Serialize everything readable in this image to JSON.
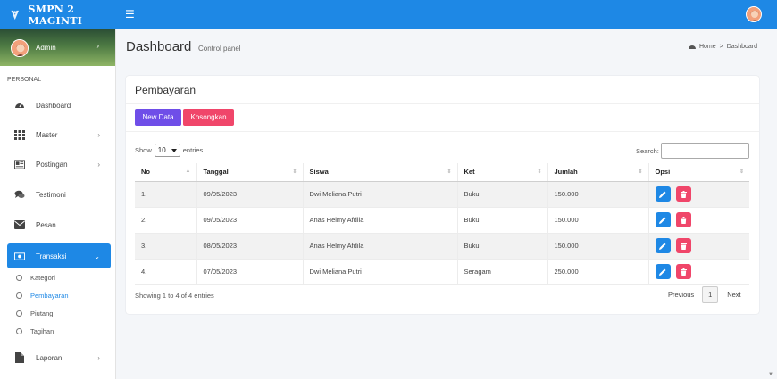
{
  "app": {
    "brand": "SMPN 2 MAGINTI",
    "menu_icon": "☰"
  },
  "colors": {
    "primary": "#1e88e5",
    "new_button": "#6f4ee8",
    "danger": "#f0466a"
  },
  "user": {
    "name": "Admin"
  },
  "sidebar": {
    "section": "PERSONAL",
    "items": [
      {
        "label": "Dashboard",
        "icon": "tachometer-icon",
        "has_chevron": false
      },
      {
        "label": "Master",
        "icon": "grid-icon",
        "has_chevron": true
      },
      {
        "label": "Postingan",
        "icon": "newspaper-icon",
        "has_chevron": true
      },
      {
        "label": "Testimoni",
        "icon": "comments-icon",
        "has_chevron": false
      },
      {
        "label": "Pesan",
        "icon": "envelope-icon",
        "has_chevron": false
      },
      {
        "label": "Transaksi",
        "icon": "money-icon",
        "has_chevron": true,
        "active": true
      },
      {
        "label": "Laporan",
        "icon": "file-icon",
        "has_chevron": true
      }
    ],
    "subitems": [
      {
        "label": "Kategori"
      },
      {
        "label": "Pembayaran",
        "active": true
      },
      {
        "label": "Piutang"
      },
      {
        "label": "Tagihan"
      }
    ]
  },
  "header": {
    "title": "Dashboard",
    "subtitle": "Control panel"
  },
  "breadcrumb": {
    "home": "Home",
    "separator": ">",
    "current": "Dashboard"
  },
  "card": {
    "title": "Pembayaran",
    "new_button": "New Data",
    "clear_button": "Kosongkan",
    "show_label": "Show",
    "entries_value": "10",
    "entries_label": "entries",
    "search_label": "Search:",
    "columns": [
      "No",
      "Tanggal",
      "Siswa",
      "Ket",
      "Jumlah",
      "Opsi"
    ],
    "rows": [
      [
        "1.",
        "09/05/2023",
        "Dwi Meliana Putri",
        "Buku",
        "150.000"
      ],
      [
        "2.",
        "09/05/2023",
        "Anas Helmy Afdila",
        "Buku",
        "150.000"
      ],
      [
        "3.",
        "08/05/2023",
        "Anas Helmy Afdila",
        "Buku",
        "150.000"
      ],
      [
        "4.",
        "07/05/2023",
        "Dwi Meliana Putri",
        "Seragam",
        "250.000"
      ]
    ],
    "info": "Showing 1 to 4 of 4 entries",
    "pager": {
      "previous": "Previous",
      "page": "1",
      "next": "Next"
    }
  }
}
